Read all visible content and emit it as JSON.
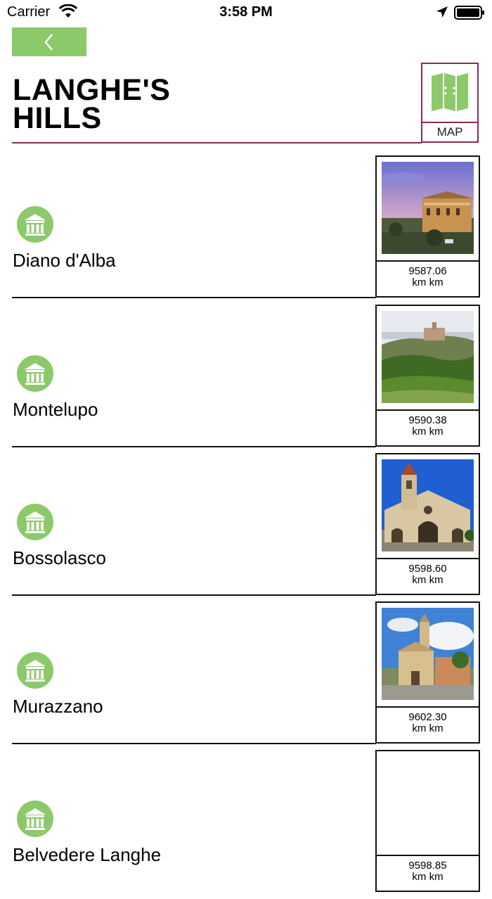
{
  "status_bar": {
    "carrier": "Carrier",
    "time": "3:58 PM"
  },
  "header": {
    "title_line1": "LANGHE'S",
    "title_line2": "HILLS",
    "map_label": "MAP"
  },
  "colors": {
    "accent_green": "#8cc96a",
    "accent_magenta": "#8a2a5c"
  },
  "icons": {
    "back": "chevron-left-icon",
    "map": "folded-map-icon",
    "poi": "museum-icon"
  },
  "items": [
    {
      "name": "Diano d'Alba",
      "distance_value": "9587.06",
      "distance_unit": "km km",
      "has_image": true
    },
    {
      "name": "Montelupo",
      "distance_value": "9590.38",
      "distance_unit": "km km",
      "has_image": true
    },
    {
      "name": "Bossolasco",
      "distance_value": "9598.60",
      "distance_unit": "km km",
      "has_image": true
    },
    {
      "name": "Murazzano",
      "distance_value": "9602.30",
      "distance_unit": "km km",
      "has_image": true
    },
    {
      "name": "Belvedere Langhe",
      "distance_value": "9598.85",
      "distance_unit": "km km",
      "has_image": false
    }
  ]
}
